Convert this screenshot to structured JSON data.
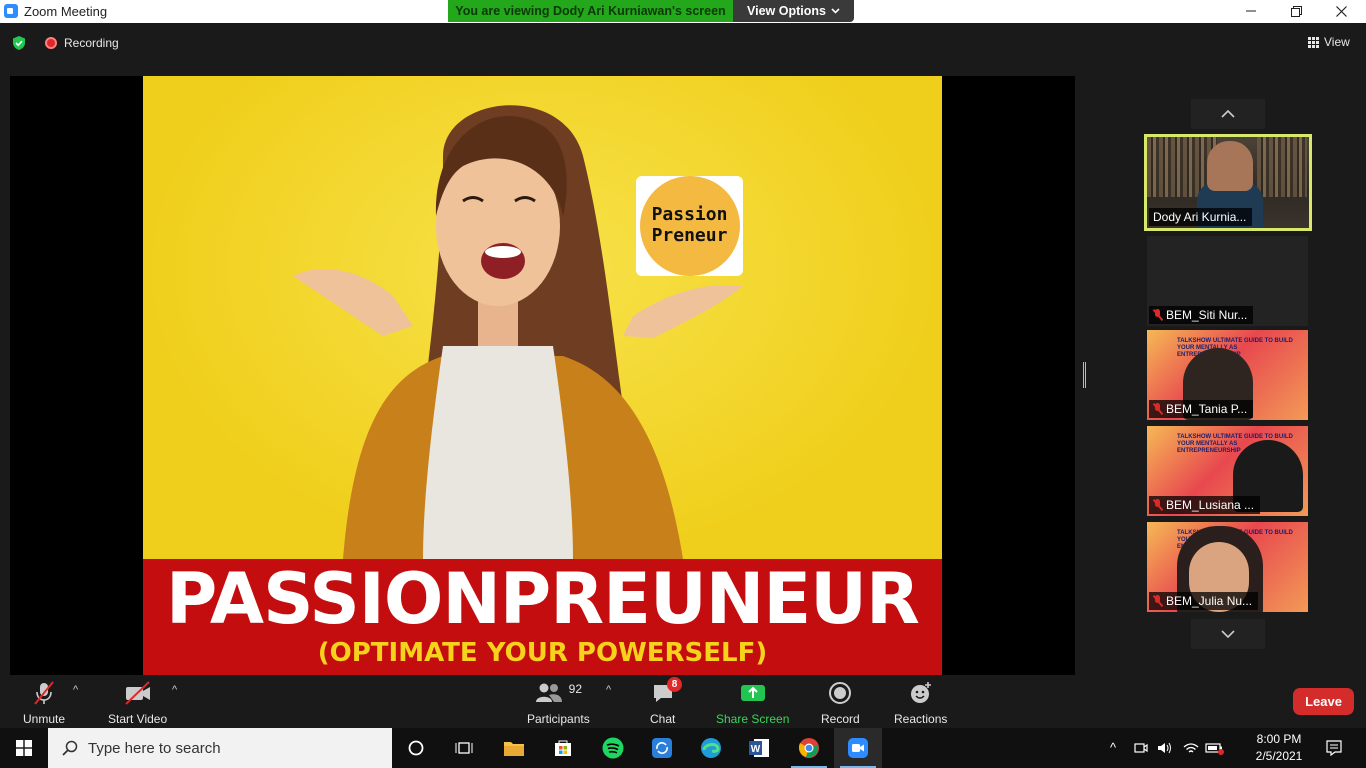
{
  "window": {
    "title": "Zoom Meeting",
    "viewing_banner": "You are viewing Dody Ari Kurniawan's screen",
    "view_options": "View Options"
  },
  "meeting": {
    "recording_label": "Recording",
    "view_label": "View"
  },
  "slide": {
    "logo_line1": "Passion",
    "logo_line2": "Preneur",
    "title": "PASSIONPREUNEUR",
    "subtitle": "(OPTIMATE YOUR POWERSELF)"
  },
  "gallery": {
    "participants": [
      {
        "name": "Dody Ari Kurnia...",
        "muted": false,
        "active": true
      },
      {
        "name": "BEM_Siti Nur...",
        "muted": true
      },
      {
        "name": "BEM_Tania P...",
        "muted": true
      },
      {
        "name": "BEM_Lusiana ...",
        "muted": true
      },
      {
        "name": "BEM_Julia Nu...",
        "muted": true
      }
    ],
    "poster_text": "TALKSHOW ULTIMATE GUIDE TO BUILD YOUR MENTALLY AS ENTREPRENEURSHIP"
  },
  "toolbar": {
    "unmute": "Unmute",
    "start_video": "Start Video",
    "participants": "Participants",
    "participant_count": "92",
    "chat": "Chat",
    "chat_badge": "8",
    "share_screen": "Share Screen",
    "record": "Record",
    "reactions": "Reactions",
    "leave": "Leave"
  },
  "taskbar": {
    "search_placeholder": "Type here to search",
    "time": "8:00 PM",
    "date": "2/5/2021"
  },
  "colors": {
    "accent_green": "#23a71b",
    "leave_red": "#d42b2b",
    "active_border": "#d8e86b",
    "slide_yellow": "#f2d420",
    "slide_red": "#c40d0f"
  }
}
